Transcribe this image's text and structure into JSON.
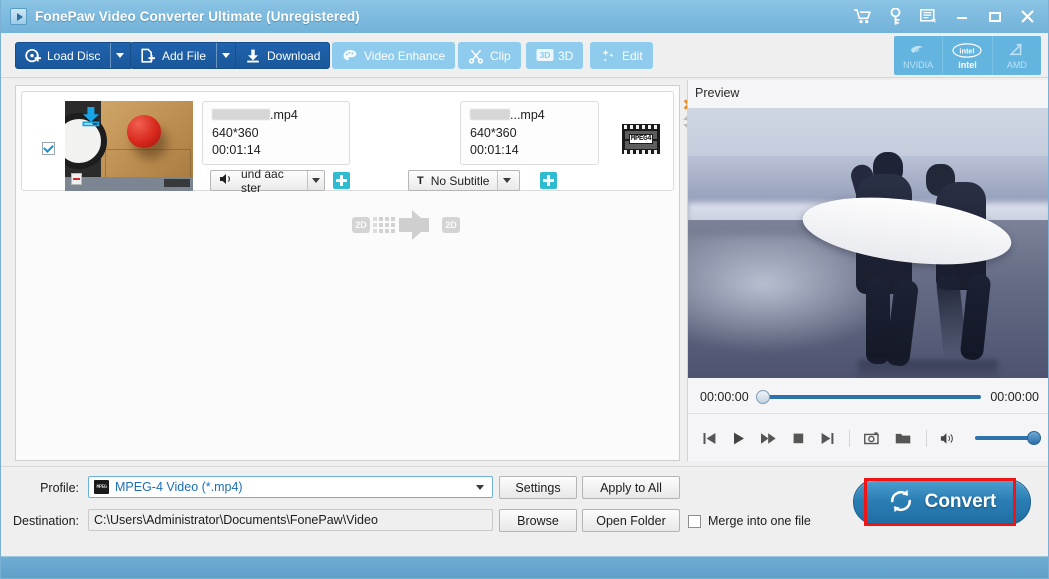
{
  "window": {
    "title": "FonePaw Video Converter Ultimate (Unregistered)",
    "logo_icon": "play-logo-icon",
    "controls": [
      {
        "name": "cart-icon",
        "label": "Buy"
      },
      {
        "name": "key-icon",
        "label": "Register"
      },
      {
        "name": "feedback-icon",
        "label": "Feedback"
      },
      {
        "name": "minimize-icon",
        "label": "Minimize"
      },
      {
        "name": "maximize-icon",
        "label": "Maximize"
      },
      {
        "name": "close-icon",
        "label": "Close"
      }
    ]
  },
  "toolbar": {
    "load_disc": "Load Disc",
    "add_file": "Add File",
    "download": "Download",
    "video_enhance": "Video Enhance",
    "clip": "Clip",
    "three_d": "3D",
    "three_d_badge": "3D",
    "edit": "Edit",
    "accel": [
      {
        "label": "NVIDIA",
        "icon": "nvidia-icon",
        "active": false
      },
      {
        "label": "intel",
        "icon": "intel-icon",
        "active": true
      },
      {
        "label": "AMD",
        "icon": "amd-icon",
        "active": false
      }
    ]
  },
  "file_list": {
    "item": {
      "checked": true,
      "thumbnail_alt": "tomato-on-cutting-board-thumbnail",
      "source": {
        "name_redacted": true,
        "name_suffix": ".mp4",
        "resolution": "640*360",
        "duration": "00:01:14"
      },
      "target": {
        "name_redacted": true,
        "name_suffix": "...mp4",
        "resolution": "640*360",
        "duration": "00:01:14"
      },
      "convert_from": "2D",
      "convert_to": "2D",
      "audio_track": "und aac ster",
      "subtitle": "No Subtitle",
      "output_format_badge": "MPEG4",
      "add_audio_label": "+",
      "add_subtitle_label": "+"
    }
  },
  "preview": {
    "title": "Preview",
    "image_alt": "two-surfers-walking-on-beach",
    "current_time": "00:00:00",
    "total_time": "00:00:00",
    "seek_position_pct": 0,
    "volume_pct": 100,
    "controls": [
      {
        "name": "previous-icon",
        "label": "Previous"
      },
      {
        "name": "play-icon",
        "label": "Play"
      },
      {
        "name": "fast-forward-icon",
        "label": "Fast Forward"
      },
      {
        "name": "stop-icon",
        "label": "Stop"
      },
      {
        "name": "next-icon",
        "label": "Next"
      },
      {
        "name": "snapshot-icon",
        "label": "Snapshot"
      },
      {
        "name": "open-folder-icon",
        "label": "Open Snapshot Folder"
      },
      {
        "name": "volume-icon",
        "label": "Volume"
      }
    ]
  },
  "bottom": {
    "profile_label": "Profile:",
    "profile_value": "MPEG-4 Video (*.mp4)",
    "profile_icon": "mpeg4-icon",
    "destination_label": "Destination:",
    "destination_value": "C:\\Users\\Administrator\\Documents\\FonePaw\\Video",
    "settings": "Settings",
    "apply_to_all": "Apply to All",
    "browse": "Browse",
    "open_folder": "Open Folder",
    "merge_label": "Merge into one file",
    "merge_checked": false,
    "convert": "Convert",
    "convert_icon": "refresh-icon",
    "highlight_color": "#f01515"
  },
  "colors": {
    "titlebar": "#7cbade",
    "primary_button": "#1a579a",
    "disabled_button": "#8fcbec",
    "accent_teal": "#2fbcd0",
    "accent_orange": "#ef8b14",
    "convert_blue": "#2b7fb5",
    "statusbar": "#6fadd3"
  }
}
